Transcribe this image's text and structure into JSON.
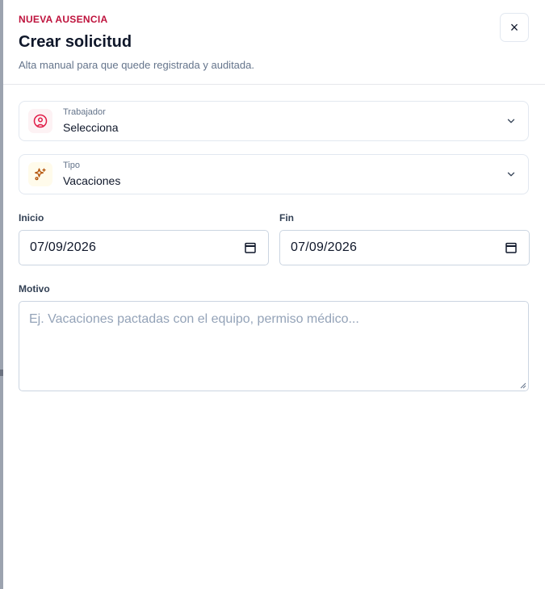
{
  "header": {
    "eyebrow": "NUEVA AUSENCIA",
    "title": "Crear solicitud",
    "subtitle": "Alta manual para que quede registrada y auditada.",
    "close_label": "×"
  },
  "fields": {
    "worker": {
      "label": "Trabajador",
      "value": "Selecciona",
      "icon": "user-circle-icon"
    },
    "type": {
      "label": "Tipo",
      "value": "Vacaciones",
      "icon": "sparkles-icon"
    },
    "start": {
      "label": "Inicio",
      "value": "07/09/2026",
      "icon": "calendar-icon"
    },
    "end": {
      "label": "Fin",
      "value": "07/09/2026",
      "icon": "calendar-icon"
    },
    "reason": {
      "label": "Motivo",
      "placeholder": "Ej. Vacaciones pactadas con el equipo, permiso médico..."
    }
  },
  "colors": {
    "accent": "#be123c",
    "type_icon": "#b45309",
    "border": "#e2e8f0",
    "muted_text": "#64748b"
  }
}
